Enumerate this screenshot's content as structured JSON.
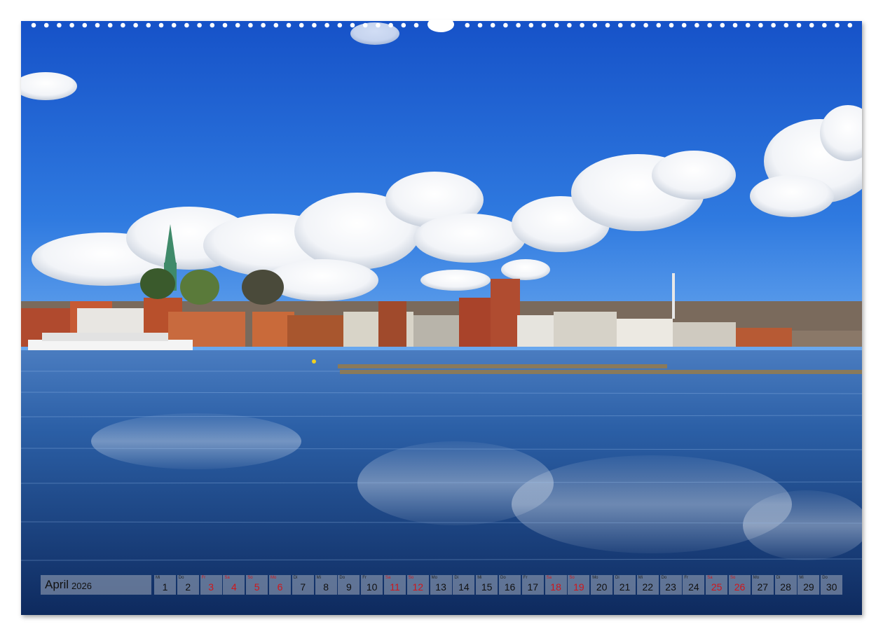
{
  "calendar": {
    "month": "April",
    "year": "2026",
    "days": [
      {
        "wd": "Mi",
        "num": "1",
        "red": false
      },
      {
        "wd": "Do",
        "num": "2",
        "red": false
      },
      {
        "wd": "Fr",
        "num": "3",
        "red": true
      },
      {
        "wd": "Sa",
        "num": "4",
        "red": true
      },
      {
        "wd": "So",
        "num": "5",
        "red": true
      },
      {
        "wd": "Mo",
        "num": "6",
        "red": true
      },
      {
        "wd": "Di",
        "num": "7",
        "red": false
      },
      {
        "wd": "Mi",
        "num": "8",
        "red": false
      },
      {
        "wd": "Do",
        "num": "9",
        "red": false
      },
      {
        "wd": "Fr",
        "num": "10",
        "red": false
      },
      {
        "wd": "Sa",
        "num": "11",
        "red": true
      },
      {
        "wd": "So",
        "num": "12",
        "red": true
      },
      {
        "wd": "Mo",
        "num": "13",
        "red": false
      },
      {
        "wd": "Di",
        "num": "14",
        "red": false
      },
      {
        "wd": "Mi",
        "num": "15",
        "red": false
      },
      {
        "wd": "Do",
        "num": "16",
        "red": false
      },
      {
        "wd": "Fr",
        "num": "17",
        "red": false
      },
      {
        "wd": "Sa",
        "num": "18",
        "red": true
      },
      {
        "wd": "So",
        "num": "19",
        "red": true
      },
      {
        "wd": "Mo",
        "num": "20",
        "red": false
      },
      {
        "wd": "Di",
        "num": "21",
        "red": false
      },
      {
        "wd": "Mi",
        "num": "22",
        "red": false
      },
      {
        "wd": "Do",
        "num": "23",
        "red": false
      },
      {
        "wd": "Fr",
        "num": "24",
        "red": false
      },
      {
        "wd": "Sa",
        "num": "25",
        "red": true
      },
      {
        "wd": "So",
        "num": "26",
        "red": true
      },
      {
        "wd": "Mo",
        "num": "27",
        "red": false
      },
      {
        "wd": "Di",
        "num": "28",
        "red": false
      },
      {
        "wd": "Mi",
        "num": "29",
        "red": false
      },
      {
        "wd": "Do",
        "num": "30",
        "red": false
      }
    ]
  },
  "colors": {
    "sky_top": "#1b5fd4",
    "sky_bottom": "#5a9ef0",
    "water_top": "#3a6fb8",
    "water_bottom": "#0f2f6a",
    "holiday_red": "#d0161a"
  }
}
